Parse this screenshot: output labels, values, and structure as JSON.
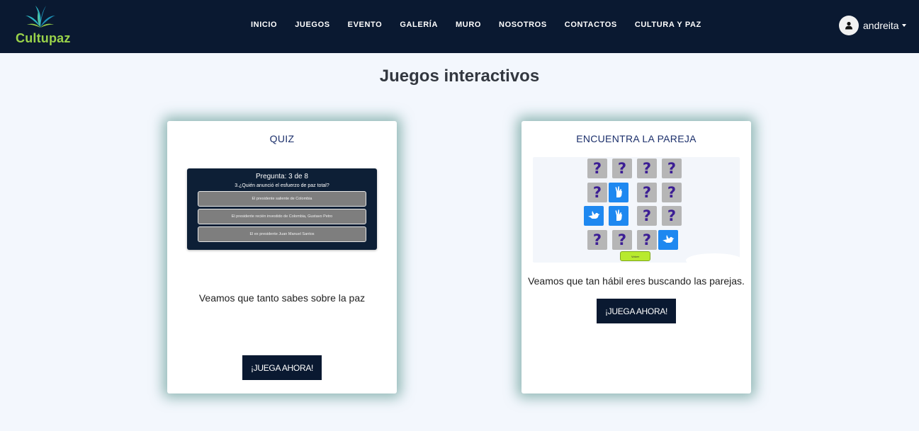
{
  "brand": {
    "name": "Cultupaz",
    "logo_icon": "lotus-leaves-icon",
    "logo_color": "#9ad34a"
  },
  "nav": {
    "items": [
      {
        "label": "INICIO"
      },
      {
        "label": "JUEGOS"
      },
      {
        "label": "EVENTO"
      },
      {
        "label": "GALERÍA"
      },
      {
        "label": "MURO"
      },
      {
        "label": "NOSOTROS"
      },
      {
        "label": "CONTACTOS"
      },
      {
        "label": "CULTURA Y PAZ"
      }
    ]
  },
  "user": {
    "name": "andreita",
    "icon": "user-icon"
  },
  "page": {
    "title": "Juegos interactivos"
  },
  "cards": [
    {
      "title": "QUIZ",
      "description": "Veamos que tanto sabes sobre la paz",
      "button_label": "¡JUEGA AHORA!",
      "preview": {
        "header": "Pregunta: 3 de 8",
        "question": "3.¿Quién anunció el esfuerzo de paz total?",
        "options": [
          "El presidente saliente de Colombia",
          "El presidente recién investido de Colombia, Gustavo Petro",
          "El ex presidente Juan Manuel Santos"
        ]
      }
    },
    {
      "title": "ENCUENTRA LA PAREJA",
      "description": "Veamos que tan hábil eres buscando las parejas.",
      "button_label": "¡JUEGA AHORA!",
      "preview": {
        "hidden_symbol": "?",
        "back_button": "Volver",
        "grid": [
          [
            "?",
            "?",
            "?",
            "?"
          ],
          [
            "?",
            "peace-hand-icon",
            "?",
            "?"
          ],
          [
            "dove-icon",
            "peace-hand-icon",
            "?",
            "?"
          ],
          [
            "?",
            "?",
            "?",
            "dove-icon"
          ]
        ]
      }
    }
  ],
  "colors": {
    "navbar": "#0a1931",
    "page_bg": "#f3f7fd",
    "button": "#0a1931",
    "tile_hidden": "#b6b6b6",
    "tile_question": "#3c1e94",
    "tile_revealed": "#1e88f0",
    "card_glow": "#3c8278"
  }
}
